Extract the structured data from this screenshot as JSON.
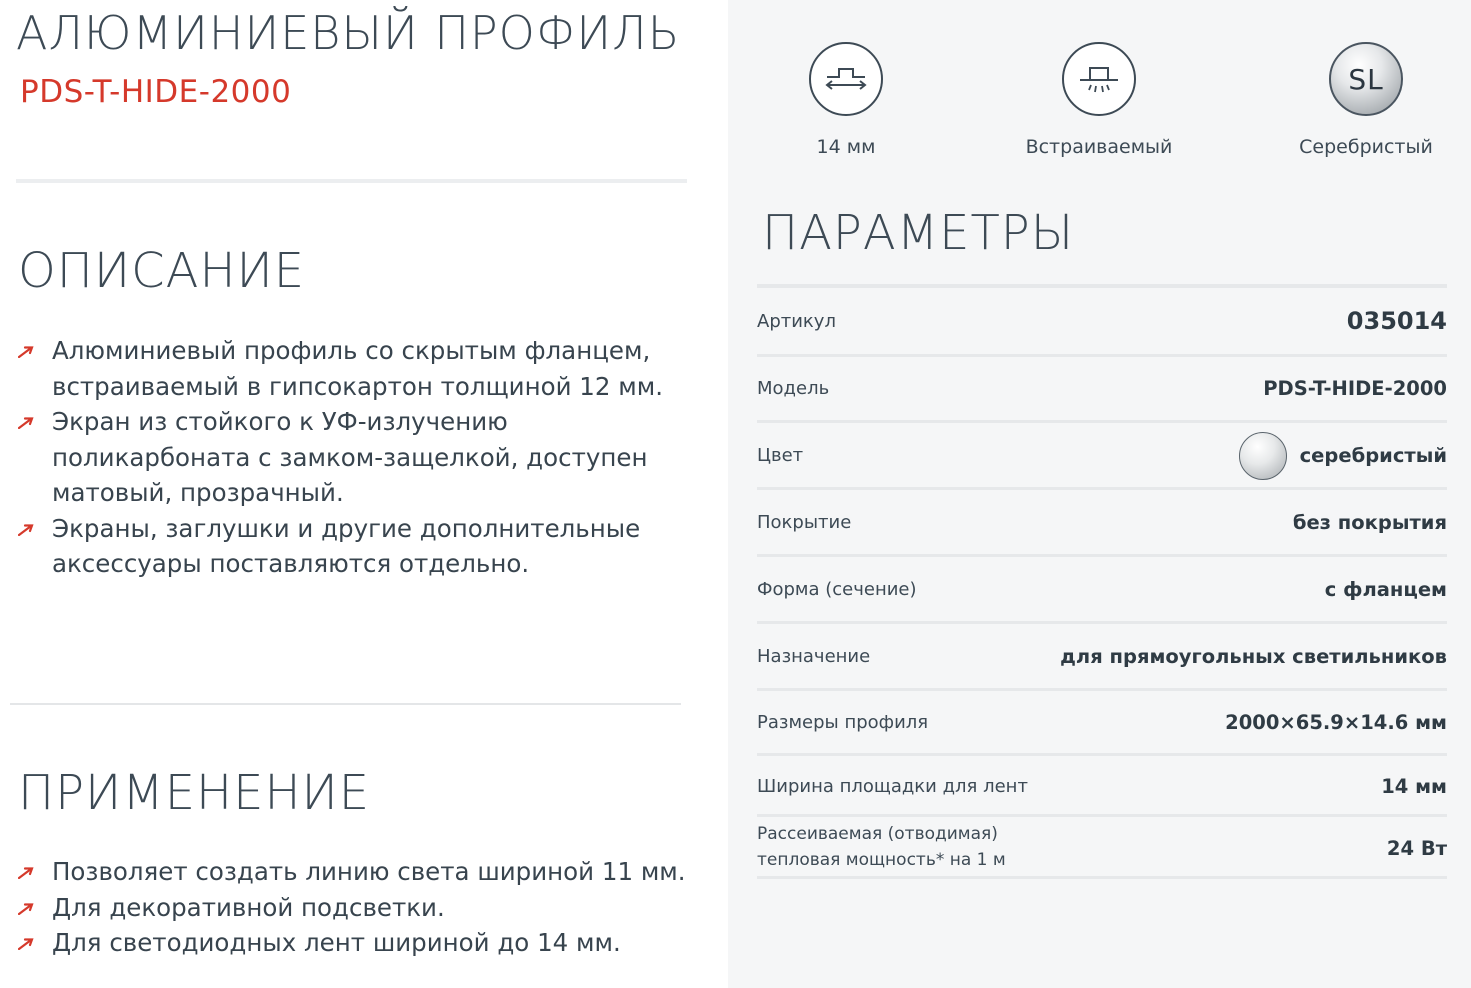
{
  "header": {
    "title": "АЛЮМИНИЕВЫЙ ПРОФИЛЬ",
    "model": "PDS-T-HIDE-2000"
  },
  "description": {
    "heading": "ОПИСАНИЕ",
    "items": [
      [
        "Алюминиевый профиль со скрытым фланцем,",
        "встраиваемый в гипсокартон толщиной 12 мм."
      ],
      [
        "Экран из стойкого к УФ-излучению",
        "поликарбоната с замком-защелкой, доступен",
        "матовый, прозрачный."
      ],
      [
        "Экраны, заглушки и другие дополнительные",
        "аксессуары поставляются отдельно."
      ]
    ]
  },
  "application": {
    "heading": "ПРИМЕНЕНИЕ",
    "items": [
      [
        "Позволяет создать линию света шириной 11 мм."
      ],
      [
        "Для декоративной подсветки."
      ],
      [
        "Для светодиодных лент шириной до 14 мм."
      ]
    ]
  },
  "features": [
    {
      "icon": "width-icon",
      "label": "14 мм"
    },
    {
      "icon": "recessed-icon",
      "label": "Встраиваемый"
    },
    {
      "icon": "silver-color-icon",
      "badge": "SL",
      "label": "Серебристый"
    }
  ],
  "parameters": {
    "heading": "ПАРАМЕТРЫ",
    "rows": [
      {
        "label": "Артикул",
        "value": "035014"
      },
      {
        "label": "Модель",
        "value": "PDS-T-HIDE-2000"
      },
      {
        "label": "Цвет",
        "value": "серебристый"
      },
      {
        "label": "Покрытие",
        "value": "без покрытия"
      },
      {
        "label": "Форма (сечение)",
        "value": "с фланцем"
      },
      {
        "label": "Назначение",
        "value": "для прямоугольных светильников"
      },
      {
        "label": "Размеры профиля",
        "value": "2000×65.9×14.6 мм"
      },
      {
        "label": "Ширина площадки для лент",
        "value": "14 мм"
      },
      {
        "label": "Рассеиваемая (отводимая)",
        "label2": "тепловая мощность* на 1 м",
        "value": "24 Вт"
      }
    ]
  },
  "colors": {
    "accent": "#d5392b",
    "text": "#3d4a55",
    "right_bg": "#f5f6f7"
  }
}
